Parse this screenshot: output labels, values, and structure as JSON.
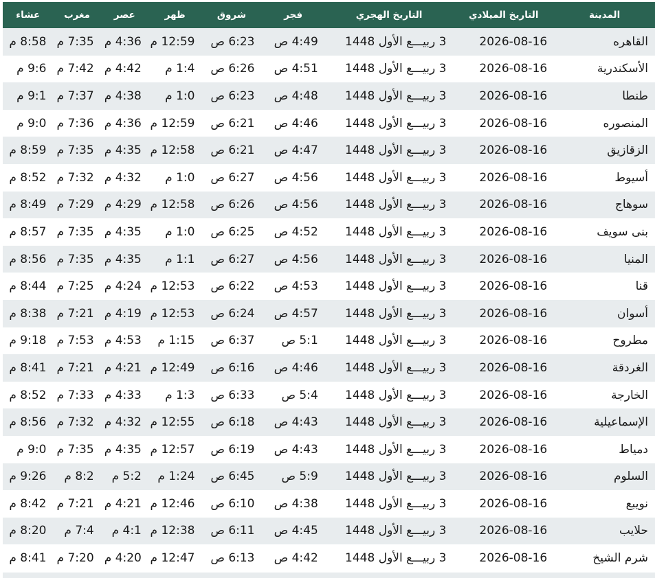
{
  "table": {
    "headers": {
      "city": "المدينة",
      "gregorian": "التاريخ الميلادي",
      "hijri": "التاريخ الهجري",
      "fajr": "فجر",
      "sunrise": "شروق",
      "dhuhr": "ظهر",
      "asr": "عصر",
      "maghrib": "مغرب",
      "isha": "عشاء"
    },
    "rows": [
      {
        "city": "القاهره",
        "gregorian": "2026-08-16",
        "hijri": "3 ربيـــع الأول 1448",
        "fajr": "4:49 ص",
        "sunrise": "6:23 ص",
        "dhuhr": "12:59 م",
        "asr": "4:36 م",
        "maghrib": "7:35 م",
        "isha": "8:58 م"
      },
      {
        "city": "الأسكندرية",
        "gregorian": "2026-08-16",
        "hijri": "3 ربيـــع الأول 1448",
        "fajr": "4:51 ص",
        "sunrise": "6:26 ص",
        "dhuhr": "1:4 م",
        "asr": "4:42 م",
        "maghrib": "7:42 م",
        "isha": "9:6 م"
      },
      {
        "city": "طنطا",
        "gregorian": "2026-08-16",
        "hijri": "3 ربيـــع الأول 1448",
        "fajr": "4:48 ص",
        "sunrise": "6:23 ص",
        "dhuhr": "1:0 م",
        "asr": "4:38 م",
        "maghrib": "7:37 م",
        "isha": "9:1 م"
      },
      {
        "city": "المنصوره",
        "gregorian": "2026-08-16",
        "hijri": "3 ربيـــع الأول 1448",
        "fajr": "4:46 ص",
        "sunrise": "6:21 ص",
        "dhuhr": "12:59 م",
        "asr": "4:36 م",
        "maghrib": "7:36 م",
        "isha": "9:0 م"
      },
      {
        "city": "الزقازيق",
        "gregorian": "2026-08-16",
        "hijri": "3 ربيـــع الأول 1448",
        "fajr": "4:47 ص",
        "sunrise": "6:21 ص",
        "dhuhr": "12:58 م",
        "asr": "4:35 م",
        "maghrib": "7:35 م",
        "isha": "8:59 م"
      },
      {
        "city": "أسيوط",
        "gregorian": "2026-08-16",
        "hijri": "3 ربيـــع الأول 1448",
        "fajr": "4:56 ص",
        "sunrise": "6:27 ص",
        "dhuhr": "1:0 م",
        "asr": "4:32 م",
        "maghrib": "7:32 م",
        "isha": "8:52 م"
      },
      {
        "city": "سوهاج",
        "gregorian": "2026-08-16",
        "hijri": "3 ربيـــع الأول 1448",
        "fajr": "4:56 ص",
        "sunrise": "6:26 ص",
        "dhuhr": "12:58 م",
        "asr": "4:29 م",
        "maghrib": "7:29 م",
        "isha": "8:49 م"
      },
      {
        "city": "بنى سويف",
        "gregorian": "2026-08-16",
        "hijri": "3 ربيـــع الأول 1448",
        "fajr": "4:52 ص",
        "sunrise": "6:25 ص",
        "dhuhr": "1:0 م",
        "asr": "4:35 م",
        "maghrib": "7:35 م",
        "isha": "8:57 م"
      },
      {
        "city": "المنيا",
        "gregorian": "2026-08-16",
        "hijri": "3 ربيـــع الأول 1448",
        "fajr": "4:56 ص",
        "sunrise": "6:27 ص",
        "dhuhr": "1:1 م",
        "asr": "4:35 م",
        "maghrib": "7:35 م",
        "isha": "8:56 م"
      },
      {
        "city": "قنا",
        "gregorian": "2026-08-16",
        "hijri": "3 ربيـــع الأول 1448",
        "fajr": "4:53 ص",
        "sunrise": "6:22 ص",
        "dhuhr": "12:53 م",
        "asr": "4:24 م",
        "maghrib": "7:25 م",
        "isha": "8:44 م"
      },
      {
        "city": "أسوان",
        "gregorian": "2026-08-16",
        "hijri": "3 ربيـــع الأول 1448",
        "fajr": "4:57 ص",
        "sunrise": "6:24 ص",
        "dhuhr": "12:53 م",
        "asr": "4:19 م",
        "maghrib": "7:21 م",
        "isha": "8:38 م"
      },
      {
        "city": "مطروح",
        "gregorian": "2026-08-16",
        "hijri": "3 ربيـــع الأول 1448",
        "fajr": "5:1 ص",
        "sunrise": "6:37 ص",
        "dhuhr": "1:15 م",
        "asr": "4:53 م",
        "maghrib": "7:53 م",
        "isha": "9:18 م"
      },
      {
        "city": "الغردقة",
        "gregorian": "2026-08-16",
        "hijri": "3 ربيـــع الأول 1448",
        "fajr": "4:46 ص",
        "sunrise": "6:16 ص",
        "dhuhr": "12:49 م",
        "asr": "4:21 م",
        "maghrib": "7:21 م",
        "isha": "8:41 م"
      },
      {
        "city": "الخارجة",
        "gregorian": "2026-08-16",
        "hijri": "3 ربيـــع الأول 1448",
        "fajr": "5:4 ص",
        "sunrise": "6:33 ص",
        "dhuhr": "1:3 م",
        "asr": "4:33 م",
        "maghrib": "7:33 م",
        "isha": "8:52 م"
      },
      {
        "city": "الإسماعيلية",
        "gregorian": "2026-08-16",
        "hijri": "3 ربيـــع الأول 1448",
        "fajr": "4:43 ص",
        "sunrise": "6:18 ص",
        "dhuhr": "12:55 م",
        "asr": "4:32 م",
        "maghrib": "7:32 م",
        "isha": "8:56 م"
      },
      {
        "city": "دمياط",
        "gregorian": "2026-08-16",
        "hijri": "3 ربيـــع الأول 1448",
        "fajr": "4:43 ص",
        "sunrise": "6:19 ص",
        "dhuhr": "12:57 م",
        "asr": "4:35 م",
        "maghrib": "7:35 م",
        "isha": "9:0 م"
      },
      {
        "city": "السلوم",
        "gregorian": "2026-08-16",
        "hijri": "3 ربيـــع الأول 1448",
        "fajr": "5:9 ص",
        "sunrise": "6:45 ص",
        "dhuhr": "1:24 م",
        "asr": "5:2 م",
        "maghrib": "8:2 م",
        "isha": "9:26 م"
      },
      {
        "city": "نويبع",
        "gregorian": "2026-08-16",
        "hijri": "3 ربيـــع الأول 1448",
        "fajr": "4:38 ص",
        "sunrise": "6:10 ص",
        "dhuhr": "12:46 م",
        "asr": "4:21 م",
        "maghrib": "7:21 م",
        "isha": "8:42 م"
      },
      {
        "city": "حلايب",
        "gregorian": "2026-08-16",
        "hijri": "3 ربيـــع الأول 1448",
        "fajr": "4:45 ص",
        "sunrise": "6:11 ص",
        "dhuhr": "12:38 م",
        "asr": "4:1 م",
        "maghrib": "7:4 م",
        "isha": "8:20 م"
      },
      {
        "city": "شرم الشيخ",
        "gregorian": "2026-08-16",
        "hijri": "3 ربيـــع الأول 1448",
        "fajr": "4:42 ص",
        "sunrise": "6:13 ص",
        "dhuhr": "12:47 م",
        "asr": "4:20 م",
        "maghrib": "7:20 م",
        "isha": "8:41 م"
      }
    ]
  },
  "colors": {
    "header_bg": "#2a6352",
    "header_text": "#ffffff",
    "row_stripe": "#e8ecee",
    "row_plain": "#ffffff",
    "cell_text": "#1a1a1a"
  }
}
